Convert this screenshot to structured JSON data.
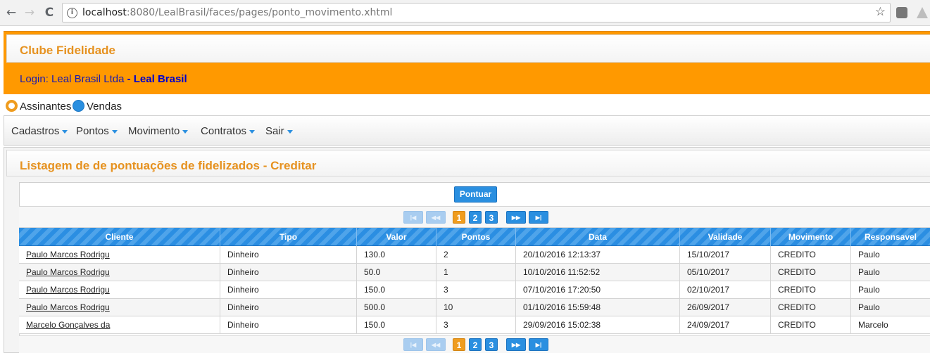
{
  "browser": {
    "url_host": "localhost",
    "url_rest": ":8080/LealBrasil/faces/pages/ponto_movimento.xhtml",
    "back_glyph": "←",
    "forward_glyph": "→",
    "reload_glyph": "C",
    "info_glyph": "i",
    "star_glyph": "☆"
  },
  "header": {
    "title": "Clube Fidelidade",
    "login_prefix": "Login: Leal Brasil Ltda",
    "login_suffix": " - Leal Brasil"
  },
  "radios": [
    {
      "label": "Assinantes",
      "selected": true
    },
    {
      "label": "Vendas",
      "selected": false
    }
  ],
  "menu": [
    {
      "label": "Cadastros"
    },
    {
      "label": "Pontos"
    },
    {
      "label": "Movimento"
    },
    {
      "label": "Contratos"
    },
    {
      "label": "Sair"
    }
  ],
  "panel": {
    "title": "Listagem de de pontuações de fidelizados - Creditar",
    "pontuar_label": "Pontuar"
  },
  "paginator": {
    "first": "|◀",
    "prev": "◀◀",
    "next": "▶▶",
    "last": "▶|",
    "pages": [
      "1",
      "2",
      "3"
    ],
    "current": "1"
  },
  "table": {
    "columns": [
      "Cliente",
      "Tipo",
      "Valor",
      "Pontos",
      "Data",
      "Validade",
      "Movimento",
      "Responsavel"
    ],
    "rows": [
      [
        "Paulo Marcos Rodrigu",
        "Dinheiro",
        "130.0",
        "2",
        "20/10/2016 12:13:37",
        "15/10/2017",
        "CREDITO",
        "Paulo"
      ],
      [
        "Paulo Marcos Rodrigu",
        "Dinheiro",
        "50.0",
        "1",
        "10/10/2016 11:52:52",
        "05/10/2017",
        "CREDITO",
        "Paulo"
      ],
      [
        "Paulo Marcos Rodrigu",
        "Dinheiro",
        "150.0",
        "3",
        "07/10/2016 17:20:50",
        "02/10/2017",
        "CREDITO",
        "Paulo"
      ],
      [
        "Paulo Marcos Rodrigu",
        "Dinheiro",
        "500.0",
        "10",
        "01/10/2016 15:59:48",
        "26/09/2017",
        "CREDITO",
        "Paulo"
      ],
      [
        "Marcelo Gonçalves da",
        "Dinheiro",
        "150.0",
        "3",
        "29/09/2016 15:02:38",
        "24/09/2017",
        "CREDITO",
        "Marcelo"
      ]
    ]
  },
  "colors": {
    "accent_orange": "#ff9900",
    "title_orange": "#e69220",
    "primary_blue": "#2a8fe0",
    "login_blue": "#0000cc"
  }
}
